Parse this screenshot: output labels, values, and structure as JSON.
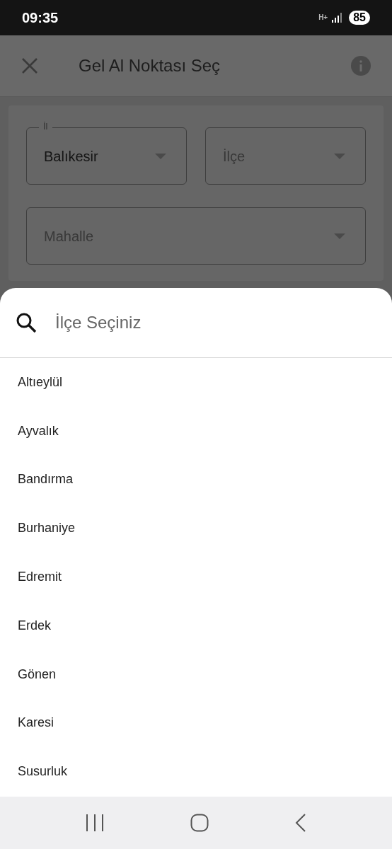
{
  "status_bar": {
    "time": "09:35",
    "network": "H+",
    "battery": "85"
  },
  "app_bar": {
    "title": "Gel Al Noktası Seç"
  },
  "form": {
    "fields": [
      {
        "label": "İl",
        "value": "Balıkesir"
      },
      {
        "placeholder": "İlçe"
      },
      {
        "placeholder": "Mahalle"
      }
    ]
  },
  "sheet": {
    "search": {
      "placeholder": "İlçe Seçiniz"
    },
    "items": [
      "Altıeylül",
      "Ayvalık",
      "Bandırma",
      "Burhaniye",
      "Edremit",
      "Erdek",
      "Gönen",
      "Karesi",
      "Susurluk"
    ]
  }
}
